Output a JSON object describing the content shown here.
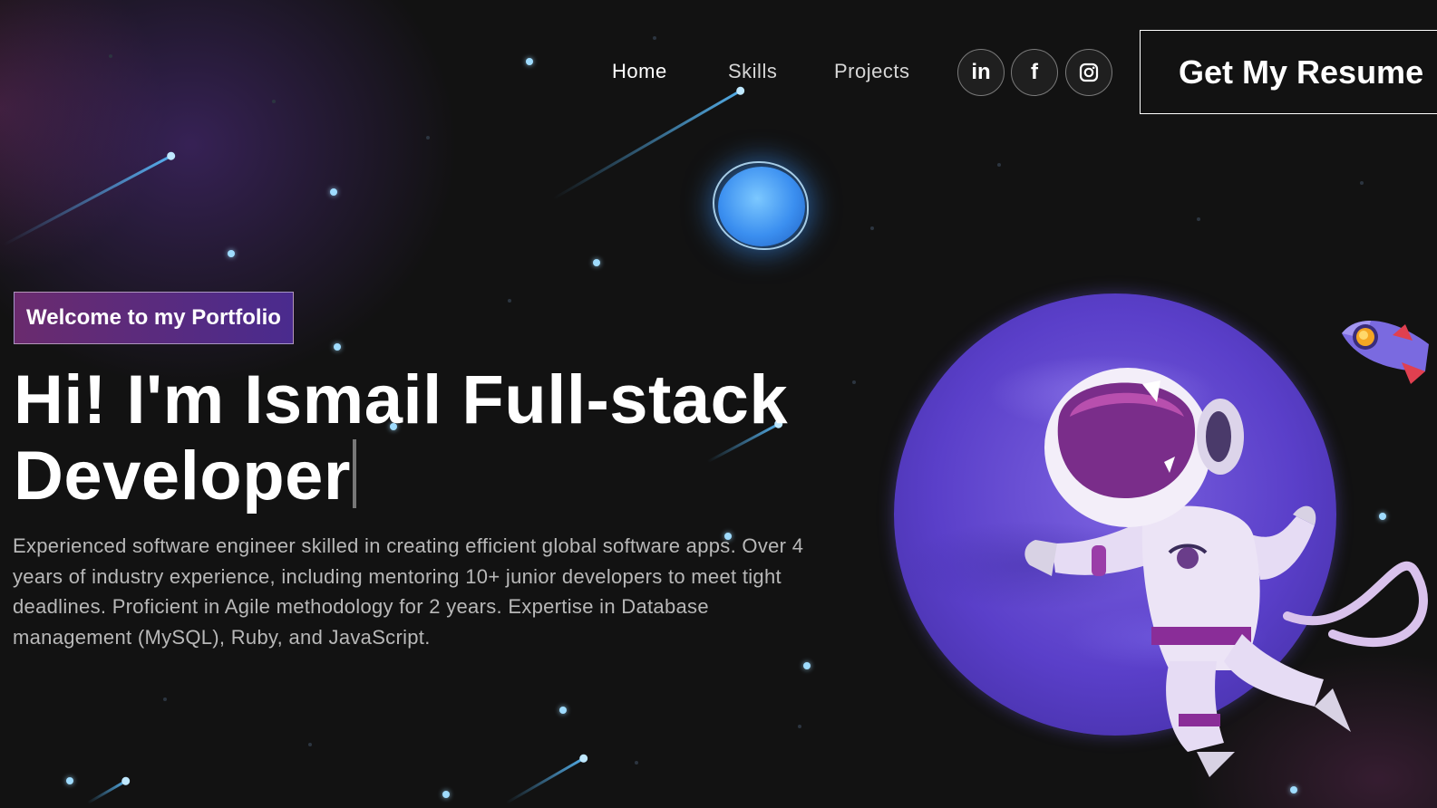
{
  "nav": {
    "links": [
      {
        "label": "Home",
        "active": true
      },
      {
        "label": "Skills",
        "active": false
      },
      {
        "label": "Projects",
        "active": false
      }
    ],
    "social": [
      {
        "label": "in",
        "icon": "linkedin-icon"
      },
      {
        "label": "f",
        "icon": "facebook-icon"
      },
      {
        "label": "",
        "icon": "instagram-icon"
      }
    ],
    "resume_label": "Get My Resume"
  },
  "hero": {
    "tagline": "Welcome to my Portfolio",
    "headline": "Hi! I'm Ismail Full-stack Developer",
    "bio": "Experienced software engineer skilled in creating efficient global software apps. Over 4 years of industry experience, including mentoring 10+ junior developers to meet tight deadlines. Proficient in Agile methodology for 2 years. Expertise in Database management (MySQL), Ruby, and JavaScript."
  },
  "colors": {
    "background": "#121212",
    "tagline_gradient_start": "#6a2b6e",
    "tagline_gradient_end": "#4a2b8e",
    "accent_blue": "#3b8ff0",
    "planet_purple": "#5a3fc9"
  }
}
